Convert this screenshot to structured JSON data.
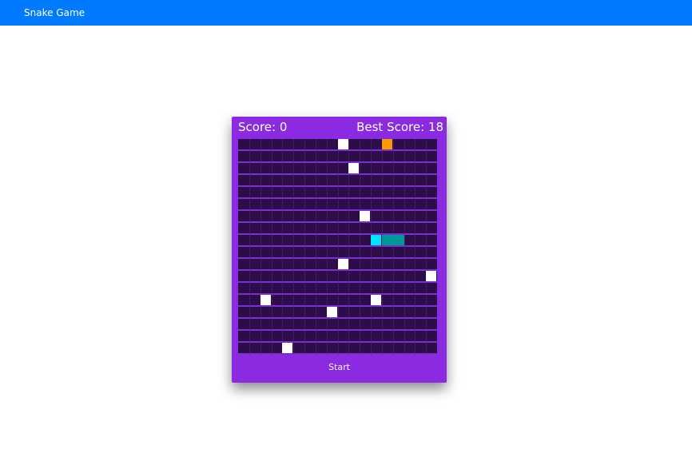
{
  "header": {
    "title": "Snake Game",
    "background": "#007bff"
  },
  "game": {
    "score_label": "Score: 0",
    "best_score_label": "Best Score: 18",
    "start_label": "Start",
    "panel_color": "#8a2be2",
    "board_color": "#2d0c4a",
    "grid": {
      "cols": 18,
      "rows": 18
    },
    "food_color": "#ff9900",
    "obstacle_color": "#ffffff",
    "snake_head_color": "#00e5ff",
    "snake_body_color": "#009999",
    "food": [
      13,
      0
    ],
    "snake_head": [
      12,
      8
    ],
    "snake_body": [
      [
        13,
        8
      ],
      [
        14,
        8
      ]
    ],
    "obstacles": [
      [
        9,
        0
      ],
      [
        10,
        2
      ],
      [
        11,
        6
      ],
      [
        9,
        10
      ],
      [
        17,
        11
      ],
      [
        2,
        13
      ],
      [
        12,
        13
      ],
      [
        8,
        14
      ],
      [
        4,
        17
      ]
    ]
  }
}
